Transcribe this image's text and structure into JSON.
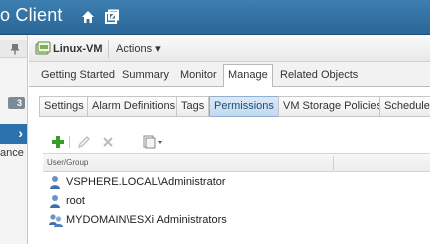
{
  "titlebar": {
    "title": "o Client"
  },
  "left_panel": {
    "count_badge": "3",
    "selected_arrow": "›",
    "item_label": "ance"
  },
  "object_header": {
    "vm_name": "Linux-VM",
    "actions_label": "Actions ▾"
  },
  "tabs": [
    {
      "label": "Getting Started"
    },
    {
      "label": "Summary"
    },
    {
      "label": "Monitor"
    },
    {
      "label": "Manage",
      "active": true
    },
    {
      "label": "Related Objects"
    }
  ],
  "subtabs": [
    {
      "label": "Settings"
    },
    {
      "label": "Alarm Definitions"
    },
    {
      "label": "Tags"
    },
    {
      "label": "Permissions",
      "active": true
    },
    {
      "label": "VM Storage Policies"
    },
    {
      "label": "Scheduled"
    }
  ],
  "grid": {
    "columns": [
      "User/Group"
    ],
    "rows": [
      {
        "name": "VSPHERE.LOCAL\\Administrator",
        "icon": "user-icon"
      },
      {
        "name": "root",
        "icon": "user-icon"
      },
      {
        "name": "MYDOMAIN\\ESXi Administrators",
        "icon": "group-icon"
      }
    ]
  },
  "colors": {
    "titlebar": "#2f6fa3",
    "selected_item": "#2b73ae",
    "active_subtab": "#c3d9ef",
    "add_icon": "#3a9a2a"
  }
}
